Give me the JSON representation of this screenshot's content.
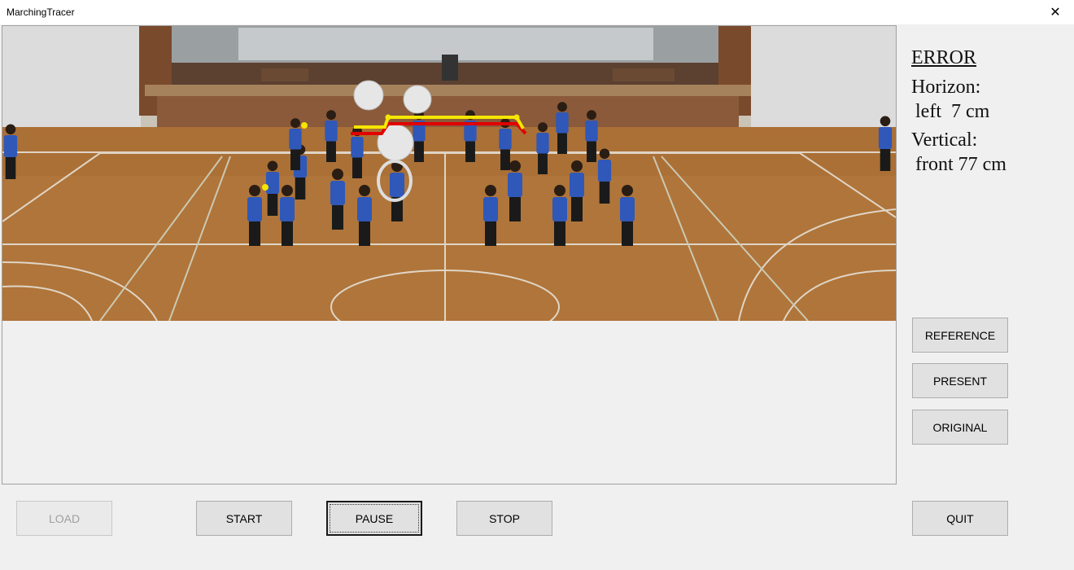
{
  "window": {
    "title": "MarchingTracer",
    "close_glyph": "✕"
  },
  "error_panel": {
    "title": "ERROR",
    "horizon_label": "Horizon:",
    "horizon_value": "left  7 cm",
    "vertical_label": "Vertical:",
    "vertical_value": "front 77 cm"
  },
  "side_buttons": {
    "reference": "REFERENCE",
    "present": "PRESENT",
    "original": "ORIGINAL",
    "quit": "QUIT"
  },
  "bottom_buttons": {
    "load": "LOAD",
    "start": "START",
    "pause": "PAUSE",
    "stop": "STOP"
  },
  "colors": {
    "reference_trace": "#f5e600",
    "present_trace": "#e00000",
    "shirt": "#2f58b8",
    "floor": "#b0753a"
  }
}
